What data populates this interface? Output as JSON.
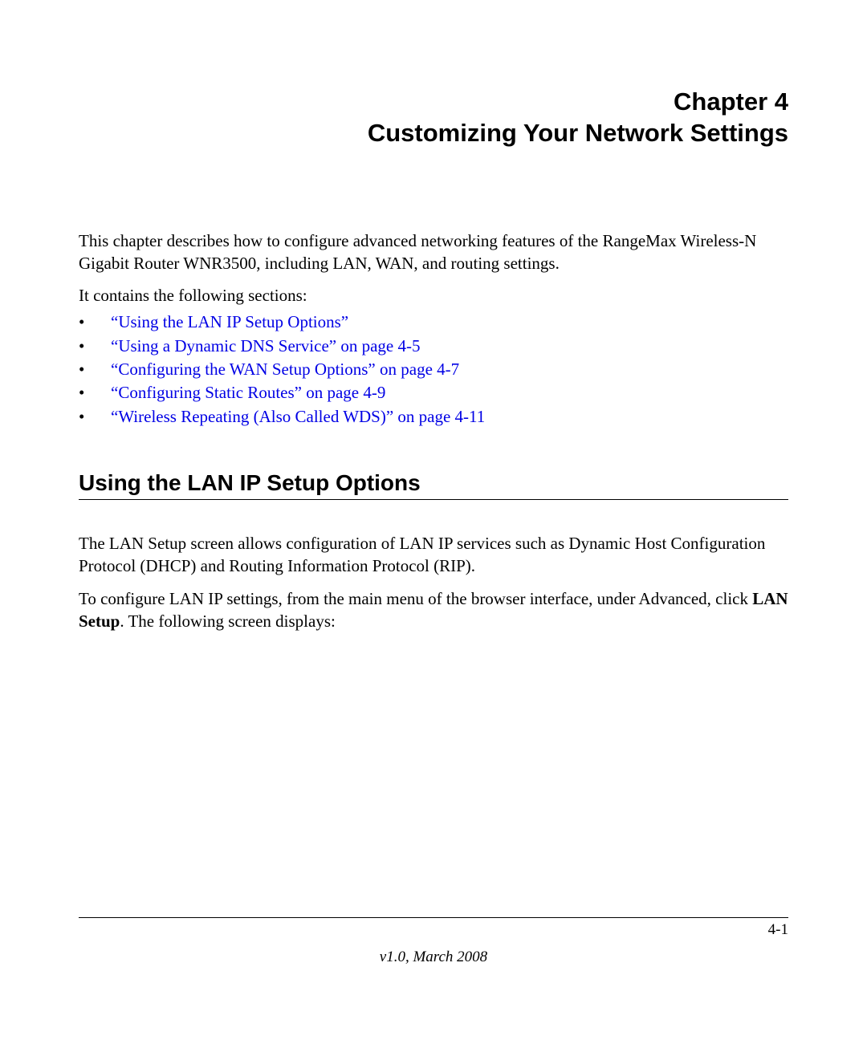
{
  "chapter": {
    "label": "Chapter 4",
    "title": "Customizing Your Network Settings"
  },
  "intro": "This chapter describes how to configure advanced networking features of the RangeMax Wireless-N Gigabit Router WNR3500, including LAN, WAN, and routing settings.",
  "sections_label": "It contains the following sections:",
  "bullets": [
    "“Using the LAN IP Setup Options”",
    "“Using a Dynamic DNS Service” on page 4-5",
    "“Configuring the WAN Setup Options” on page 4-7",
    "“Configuring Static Routes” on page 4-9",
    "“Wireless Repeating (Also Called WDS)” on page 4-11"
  ],
  "section1": {
    "heading": "Using the LAN IP Setup Options",
    "p1": "The LAN Setup screen allows configuration of LAN IP services such as Dynamic Host Configuration Protocol (DHCP) and Routing Information Protocol (RIP).",
    "p2a": "To configure LAN IP settings, from the main menu of the browser interface, under Advanced, click ",
    "p2b_bold": "LAN Setup",
    "p2c": ". The following screen displays:"
  },
  "footer": {
    "page_number": "4-1",
    "version": "v1.0, March 2008"
  }
}
